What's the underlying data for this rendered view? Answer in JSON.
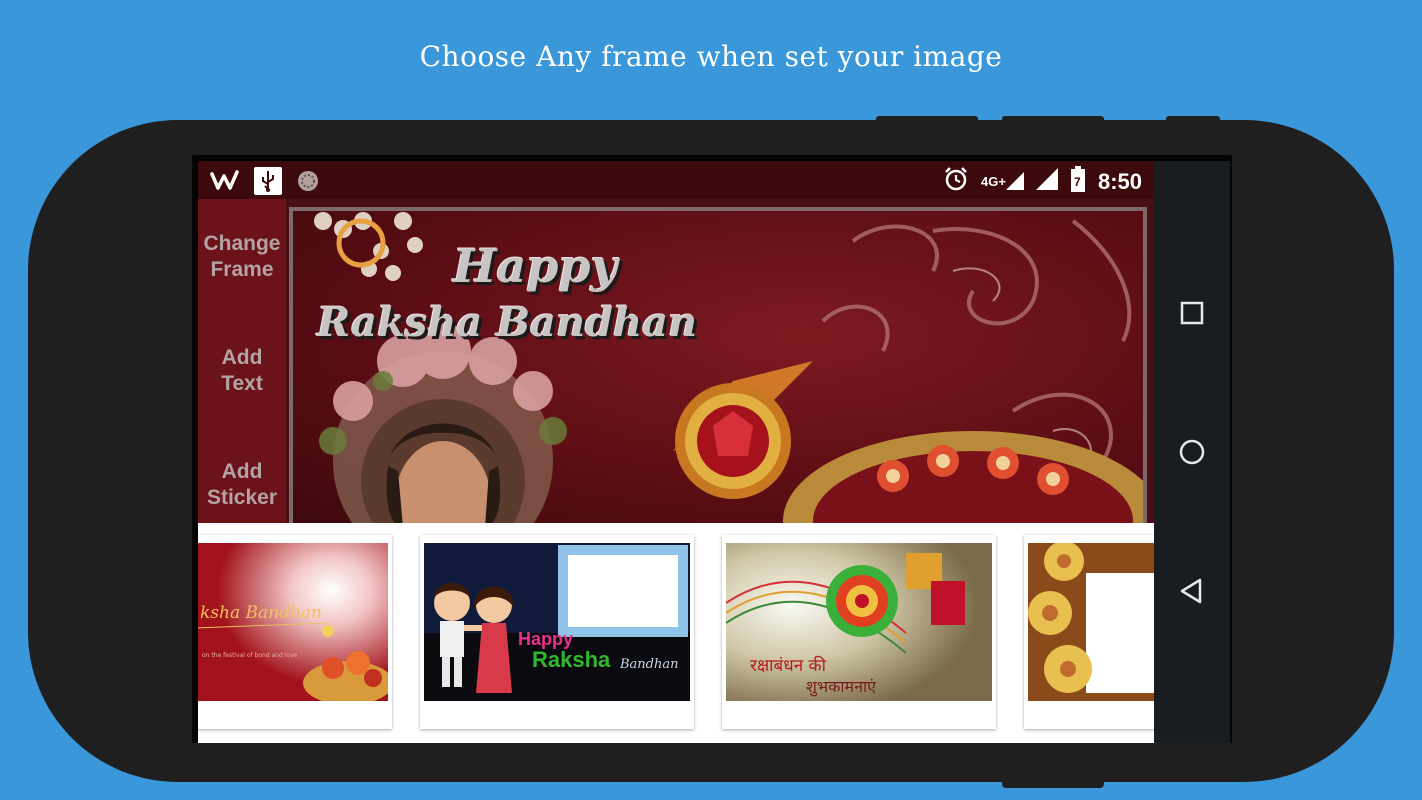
{
  "headline": "Choose Any frame when set your image",
  "status_bar": {
    "left_icons": [
      "wish-icon",
      "usb-icon",
      "sync-icon"
    ],
    "network_label": "4G+",
    "battery_level": "7",
    "time": "8:50",
    "right_icons": [
      "alarm-icon",
      "signal-4g-icon",
      "signal-icon",
      "battery-icon"
    ]
  },
  "sidebar": {
    "items": [
      {
        "label": "Change\nFrame"
      },
      {
        "label": "Add\nText"
      },
      {
        "label": "Add\nSticker"
      }
    ]
  },
  "frame_preview": {
    "line1": "Happy",
    "line2": "Raksha Bandhan"
  },
  "thumbnails": [
    {
      "caption": "ksha Bandhan"
    },
    {
      "line1": "Happy",
      "line2": "Raksha",
      "line3": "Bandhan"
    },
    {
      "line1": "रक्षाबंधन की",
      "line2": "शुभकामनाएं"
    },
    {
      "caption": ""
    }
  ],
  "nav_icons": [
    "recents-square-icon",
    "home-circle-icon",
    "back-triangle-icon"
  ],
  "colors": {
    "background": "#3a97d9",
    "phone": "#1f1f1f",
    "status_bar": "#3c0a0d",
    "sidebar": "#6b1318",
    "accent_green": "#2eb82e",
    "accent_pink": "#e8318a"
  }
}
